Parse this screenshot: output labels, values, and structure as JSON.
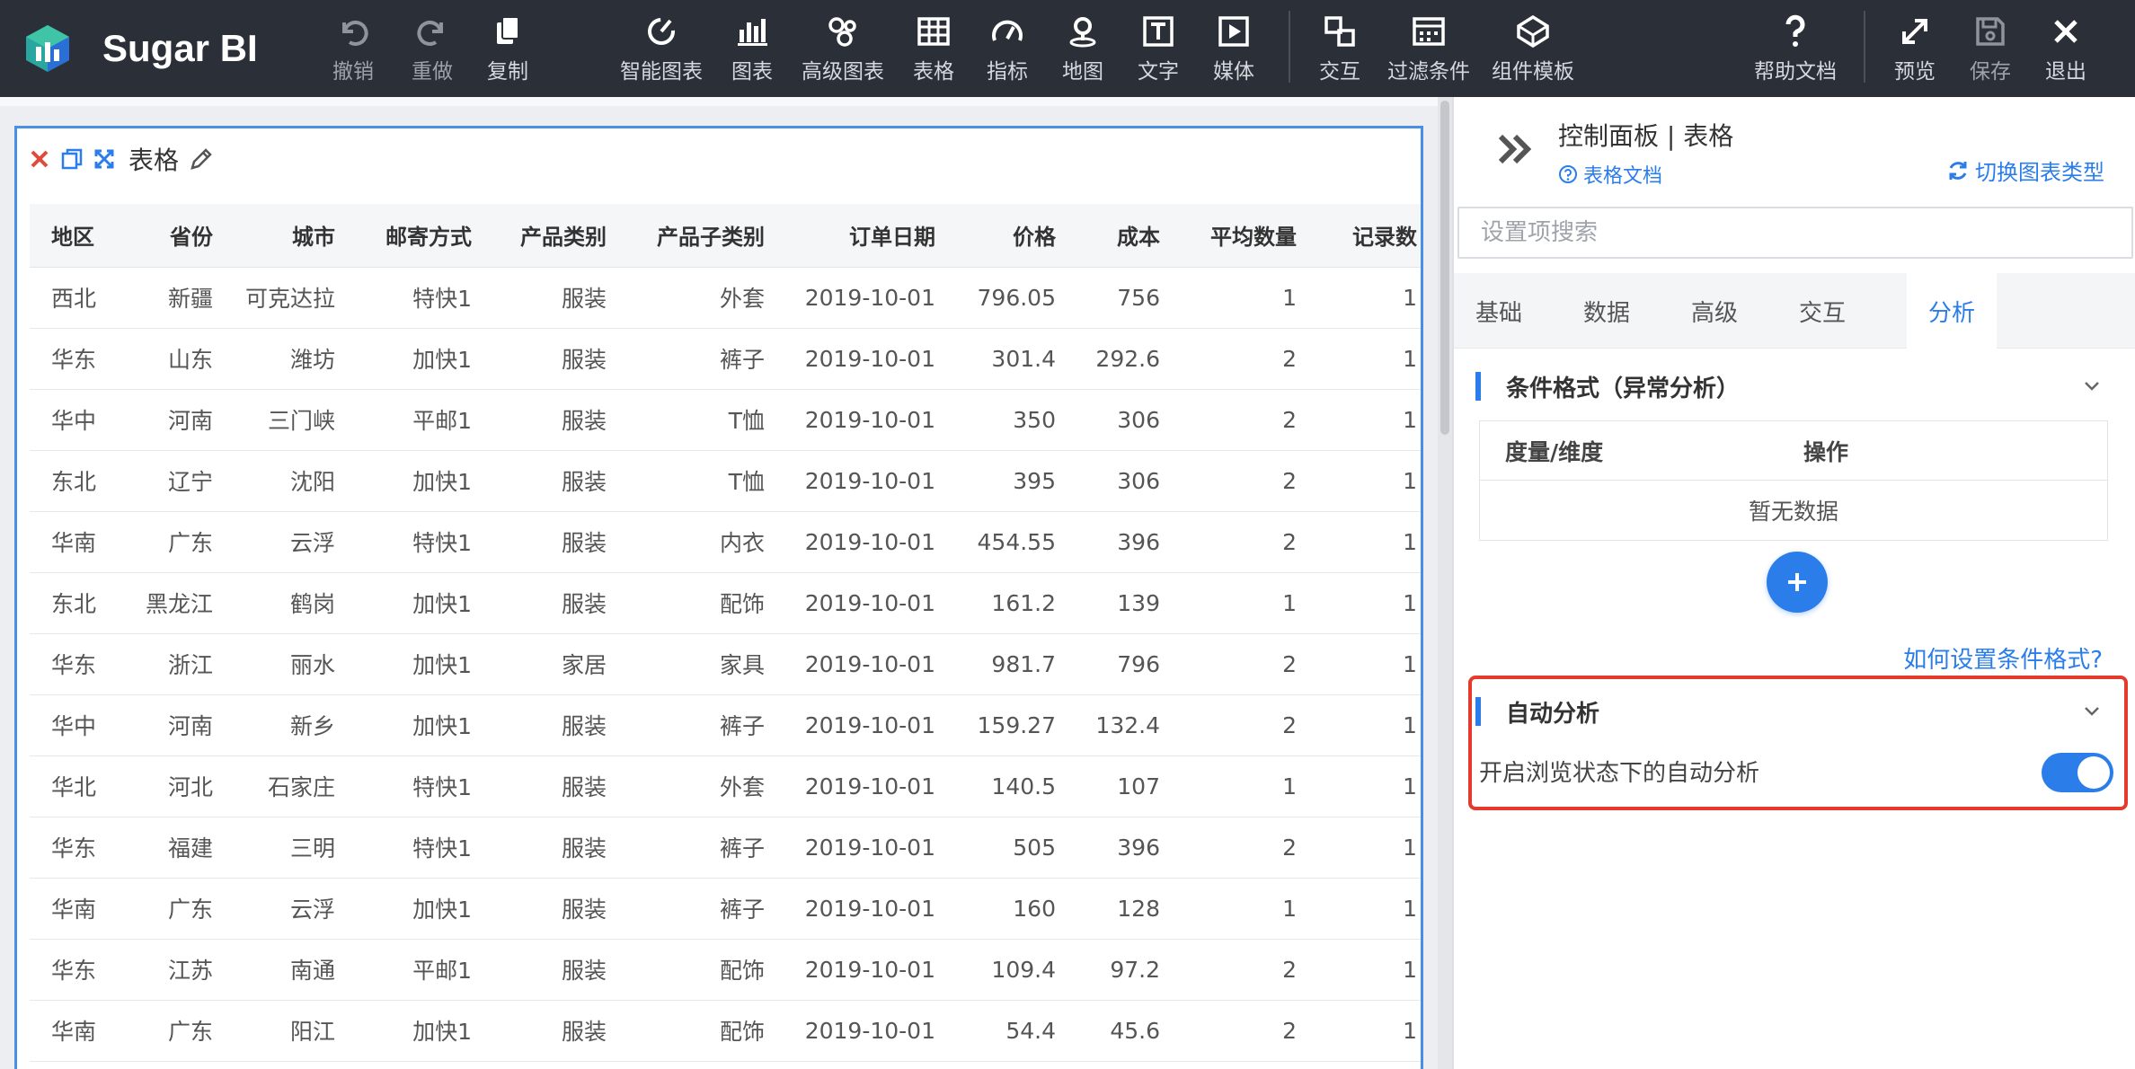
{
  "app": {
    "name": "Sugar BI"
  },
  "toolbar": {
    "undo": "撤销",
    "redo": "重做",
    "copy": "复制",
    "smart_chart": "智能图表",
    "chart": "图表",
    "advanced_chart": "高级图表",
    "table": "表格",
    "indicator": "指标",
    "map": "地图",
    "text": "文字",
    "media": "媒体",
    "interaction": "交互",
    "filter": "过滤条件",
    "component_template": "组件模板",
    "help": "帮助文档",
    "preview": "预览",
    "save": "保存",
    "exit": "退出"
  },
  "widget": {
    "title": "表格",
    "columns": [
      "地区",
      "省份",
      "城市",
      "邮寄方式",
      "产品类别",
      "产品子类别",
      "订单日期",
      "价格",
      "成本",
      "平均数量",
      "记录数"
    ],
    "rows": [
      [
        "西北",
        "新疆",
        "可克达拉",
        "特快1",
        "服装",
        "外套",
        "2019-10-01",
        "796.05",
        "756",
        "1",
        "1"
      ],
      [
        "华东",
        "山东",
        "潍坊",
        "加快1",
        "服装",
        "裤子",
        "2019-10-01",
        "301.4",
        "292.6",
        "2",
        "1"
      ],
      [
        "华中",
        "河南",
        "三门峡",
        "平邮1",
        "服装",
        "T恤",
        "2019-10-01",
        "350",
        "306",
        "2",
        "1"
      ],
      [
        "东北",
        "辽宁",
        "沈阳",
        "加快1",
        "服装",
        "T恤",
        "2019-10-01",
        "395",
        "306",
        "2",
        "1"
      ],
      [
        "华南",
        "广东",
        "云浮",
        "特快1",
        "服装",
        "内衣",
        "2019-10-01",
        "454.55",
        "396",
        "2",
        "1"
      ],
      [
        "东北",
        "黑龙江",
        "鹤岗",
        "加快1",
        "服装",
        "配饰",
        "2019-10-01",
        "161.2",
        "139",
        "1",
        "1"
      ],
      [
        "华东",
        "浙江",
        "丽水",
        "加快1",
        "家居",
        "家具",
        "2019-10-01",
        "981.7",
        "796",
        "2",
        "1"
      ],
      [
        "华中",
        "河南",
        "新乡",
        "加快1",
        "服装",
        "裤子",
        "2019-10-01",
        "159.27",
        "132.4",
        "2",
        "1"
      ],
      [
        "华北",
        "河北",
        "石家庄",
        "特快1",
        "服装",
        "外套",
        "2019-10-01",
        "140.5",
        "107",
        "1",
        "1"
      ],
      [
        "华东",
        "福建",
        "三明",
        "特快1",
        "服装",
        "裤子",
        "2019-10-01",
        "505",
        "396",
        "2",
        "1"
      ],
      [
        "华南",
        "广东",
        "云浮",
        "加快1",
        "服装",
        "裤子",
        "2019-10-01",
        "160",
        "128",
        "1",
        "1"
      ],
      [
        "华东",
        "江苏",
        "南通",
        "平邮1",
        "服装",
        "配饰",
        "2019-10-01",
        "109.4",
        "97.2",
        "2",
        "1"
      ],
      [
        "华南",
        "广东",
        "阳江",
        "加快1",
        "服装",
        "配饰",
        "2019-10-01",
        "54.4",
        "45.6",
        "2",
        "1"
      ]
    ]
  },
  "panel": {
    "title": "控制面板 | 表格",
    "doc_link": "表格文档",
    "switch_link": "切换图表类型",
    "search_placeholder": "设置项搜索",
    "tabs": [
      "基础",
      "数据",
      "高级",
      "交互",
      "分析"
    ],
    "active_tab": "分析",
    "condition_section": {
      "title": "条件格式（异常分析）",
      "col_measure": "度量/维度",
      "col_action": "操作",
      "empty": "暂无数据",
      "help_link": "如何设置条件格式?"
    },
    "auto_section": {
      "title": "自动分析",
      "toggle_label": "开启浏览状态下的自动分析",
      "enabled": true
    }
  },
  "colors": {
    "accent": "#2b7de9",
    "topbar": "#2b2f37",
    "highlight_border": "#e53b2c",
    "widget_border": "#4a8fe7"
  }
}
